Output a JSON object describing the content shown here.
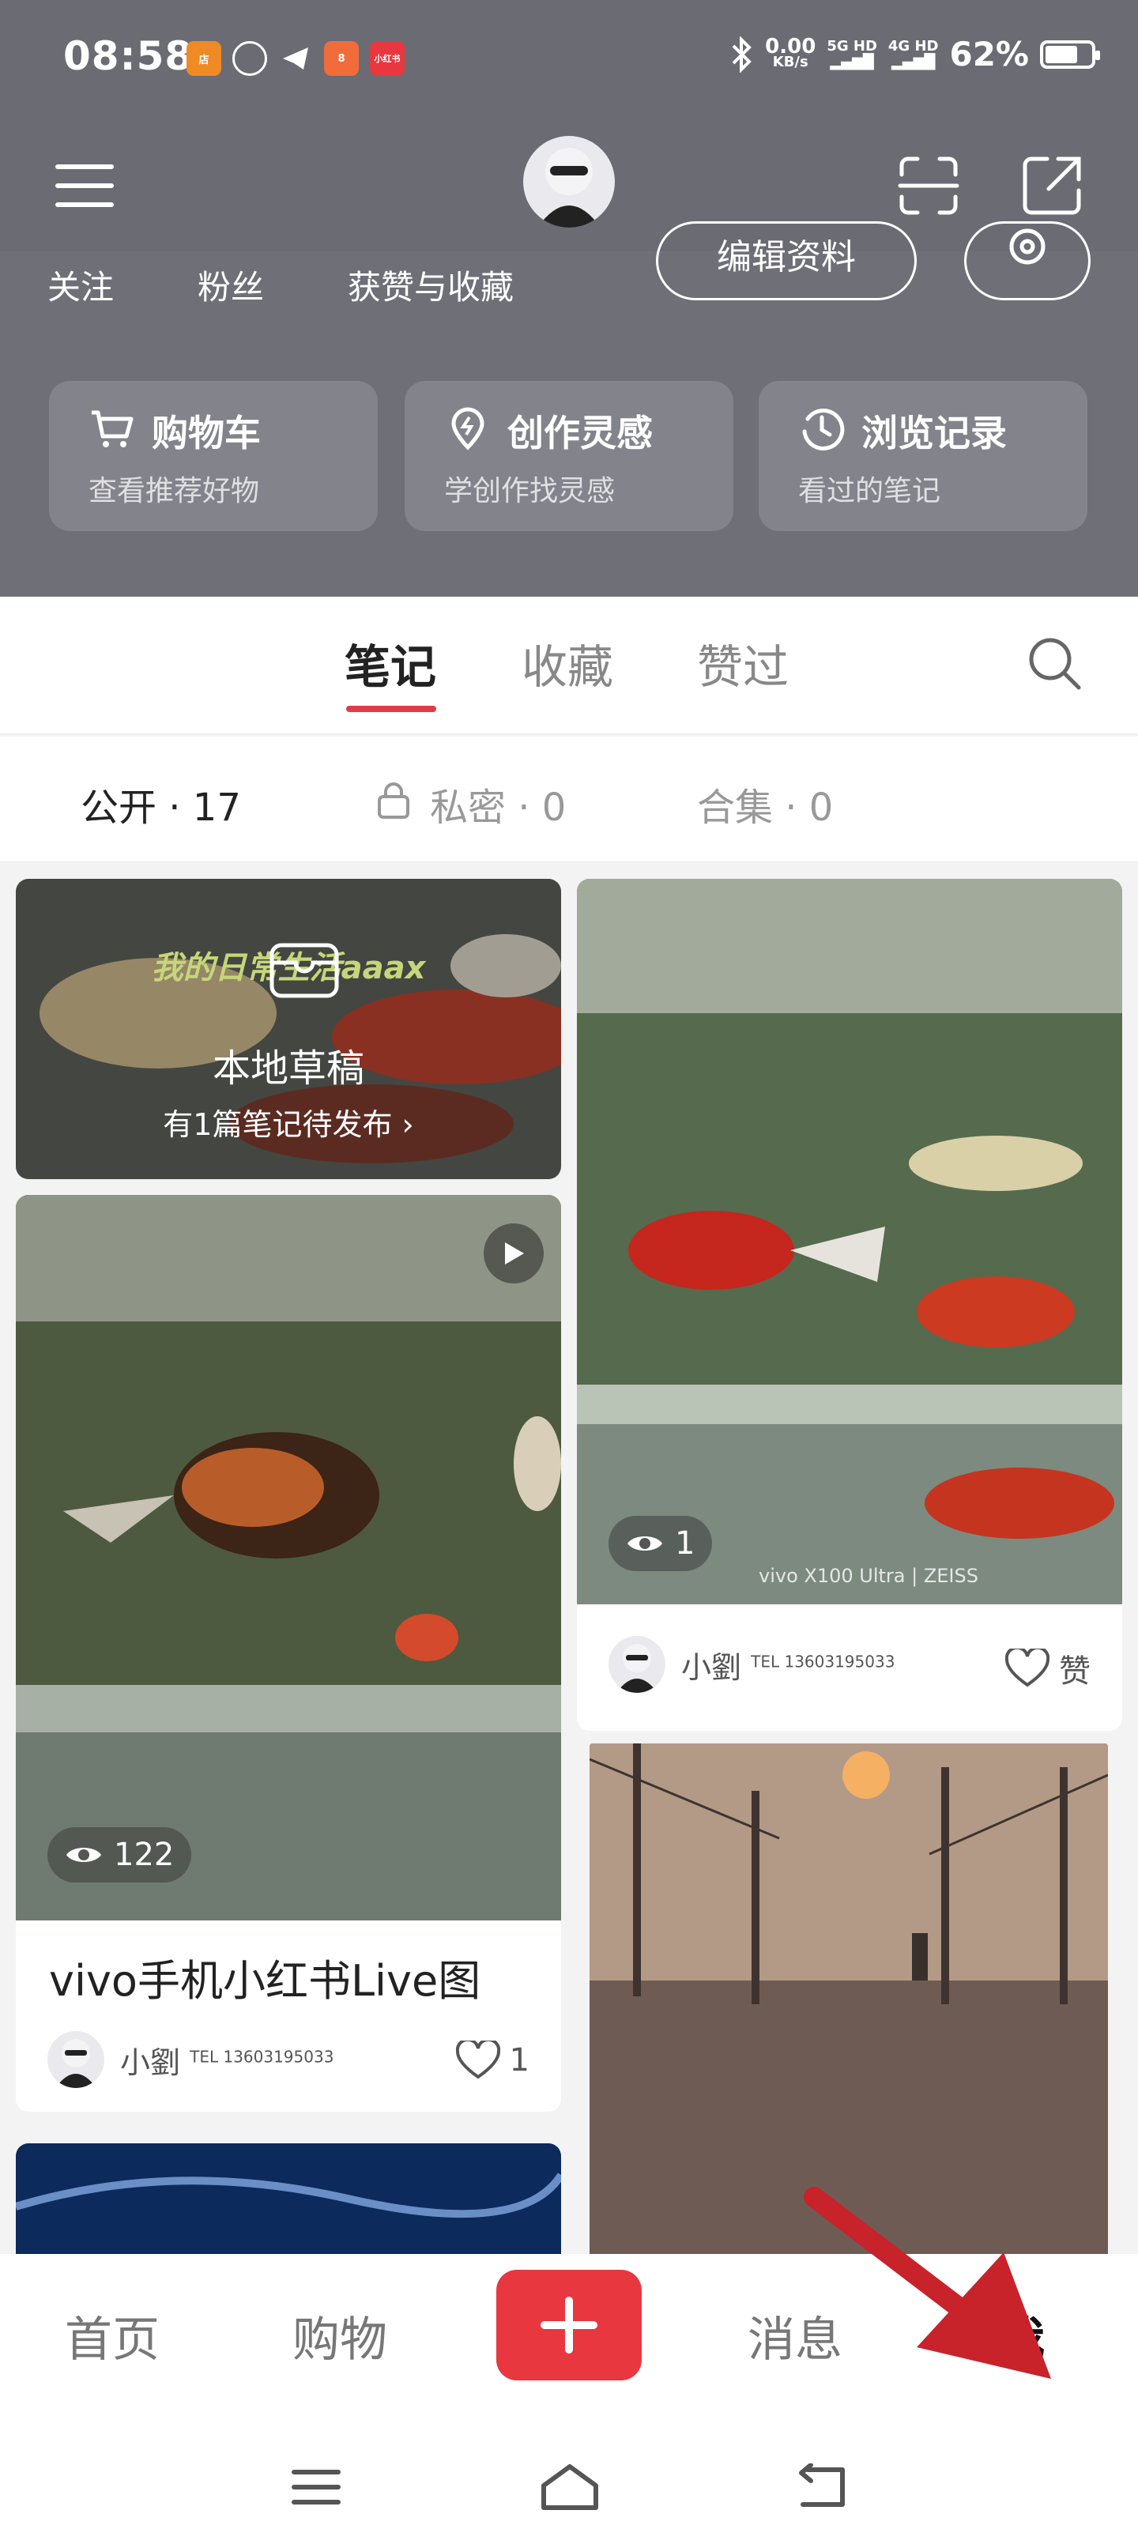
{
  "status_bar": {
    "time": "08:58",
    "net_speed": "0.00",
    "net_unit": "KB/s",
    "sig1": "5G HD",
    "sig2": "4G HD",
    "battery": "62%",
    "app_icons": [
      "store-app-icon",
      "wechat-icon",
      "telegram-icon",
      "app4-icon",
      "xiaohongshu-icon"
    ],
    "battery_level": 0.62
  },
  "header": {
    "stats": {
      "follow": "关注",
      "fans": "粉丝",
      "likes": "获赞与收藏"
    },
    "edit_profile": "编辑资料",
    "quick": [
      {
        "title": "购物车",
        "sub": "查看推荐好物",
        "icon": "cart-icon"
      },
      {
        "title": "创作灵感",
        "sub": "学创作找灵感",
        "icon": "bulb-icon"
      },
      {
        "title": "浏览记录",
        "sub": "看过的笔记",
        "icon": "clock-icon"
      }
    ]
  },
  "tabs": {
    "notes": "笔记",
    "favorites": "收藏",
    "liked": "赞过"
  },
  "subtabs": {
    "public": "公开 · 17",
    "private": "私密 · 0",
    "collection": "合集 · 0"
  },
  "feed": {
    "draft": {
      "watermark": "我的日常生活aaax",
      "title": "本地草稿",
      "sub": "有1篇笔记待发布"
    },
    "card1": {
      "views": "122",
      "title": "vivo手机小红书Live图",
      "author": "小劉",
      "tel": "TEL 13603195033",
      "likes": "1"
    },
    "card2": {
      "views": "1",
      "author": "小劉",
      "tel": "TEL 13603195033",
      "like_label": "赞",
      "watermark": "vivo X100 Ultra | ZEISS"
    }
  },
  "bottom_nav": {
    "home": "首页",
    "shop": "购物",
    "messages": "消息",
    "me": "我"
  },
  "colors": {
    "header_bg": "#6f6f78",
    "accent": "#e43a47",
    "plus": "#e8373f"
  }
}
